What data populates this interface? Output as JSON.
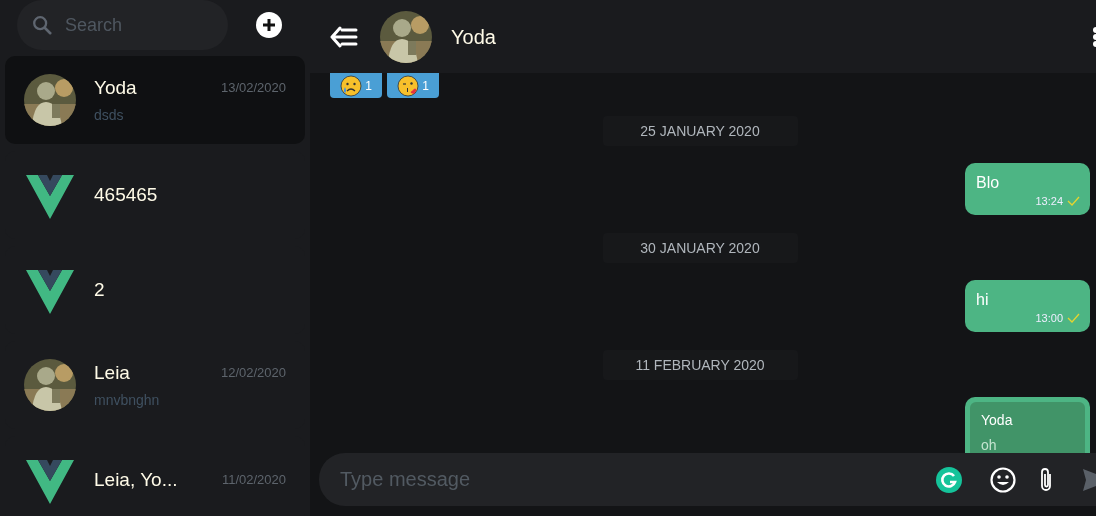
{
  "sidebar": {
    "search": {
      "placeholder": "Search"
    },
    "rooms": [
      {
        "name": "Yoda",
        "date": "13/02/2020",
        "last_message": "dsds",
        "kind": "picture",
        "selected": true
      },
      {
        "name": "465465",
        "kind": "logo",
        "selected": false
      },
      {
        "name": "2",
        "kind": "logo",
        "selected": false
      },
      {
        "name": "Leia",
        "date": "12/02/2020",
        "last_message": "mnvbnghn",
        "kind": "picture",
        "selected": false
      },
      {
        "name": "Leia, Yo...",
        "date": "11/02/2020",
        "kind": "logo",
        "selected": false
      }
    ]
  },
  "header": {
    "title": "Yoda"
  },
  "reactions": [
    {
      "kind": "sad",
      "count": "1"
    },
    {
      "kind": "kiss",
      "count": "1"
    }
  ],
  "messages": [
    {
      "kind": "date",
      "text": "25 JANUARY 2020"
    },
    {
      "kind": "bubble",
      "text": "Blo",
      "time": "13:24",
      "seen": true
    },
    {
      "kind": "date",
      "text": "30 JANUARY 2020"
    },
    {
      "kind": "bubble",
      "text": "hi",
      "time": "13:00",
      "seen": true
    },
    {
      "kind": "date",
      "text": "11 FEBRUARY 2020"
    },
    {
      "kind": "reply",
      "reply_to": "Yoda",
      "reply_text": "oh"
    }
  ],
  "composer": {
    "placeholder": "Type message"
  }
}
